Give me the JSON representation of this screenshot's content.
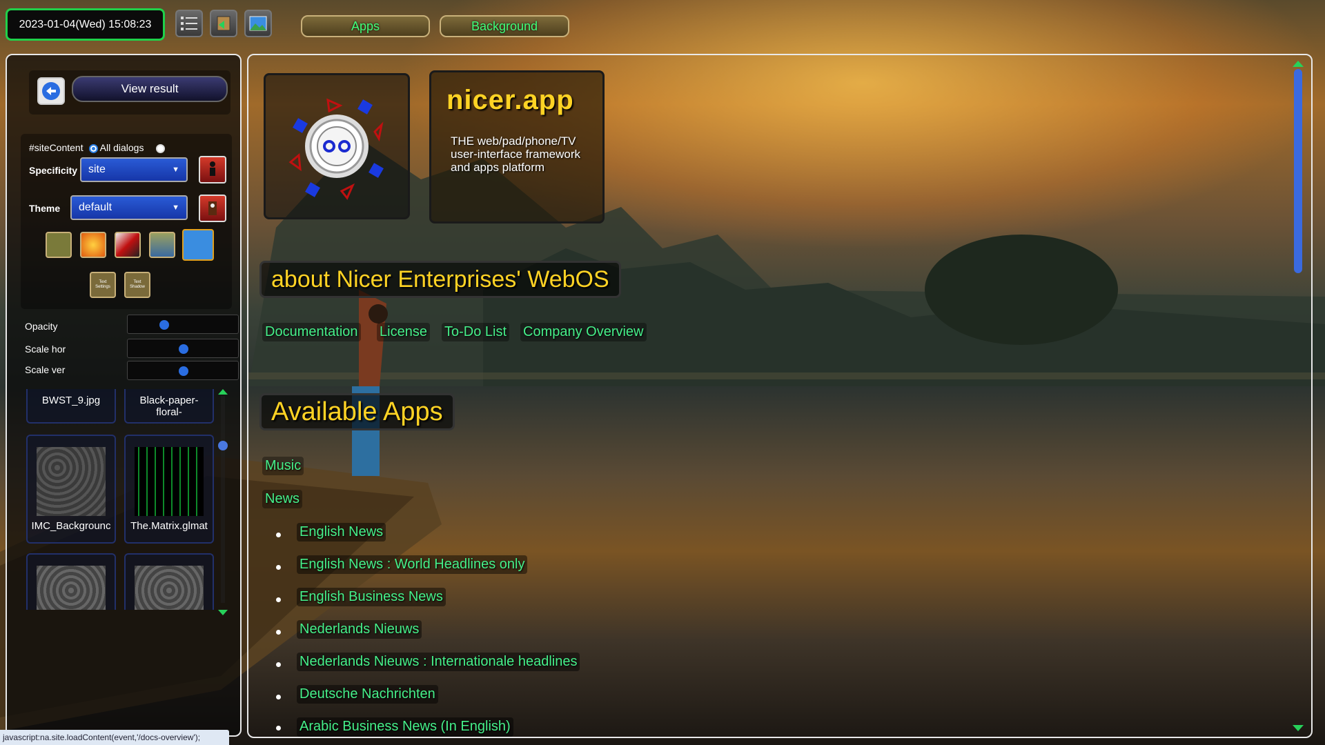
{
  "topbar": {
    "datetime": "2023-01-04(Wed) 15:08:23",
    "icons": [
      "list-icon",
      "upload-icon",
      "landscape-icon"
    ],
    "apps_label": "Apps",
    "background_label": "Background"
  },
  "leftpanel": {
    "view_result_label": "View result",
    "scope": {
      "site_content_label": "#siteContent",
      "all_dialogs_label": "All dialogs",
      "selected": "#siteContent"
    },
    "specificity": {
      "label": "Specificity",
      "value": "site"
    },
    "theme": {
      "label": "Theme",
      "value": "default"
    },
    "text_settings_label": "Text Settings",
    "text_shadow_label": "Text Shadow",
    "sliders": [
      {
        "label": "Opacity",
        "value": 0.33
      },
      {
        "label": "Scale hor",
        "value": 0.5
      },
      {
        "label": "Scale ver",
        "value": 0.5
      }
    ],
    "thumbnails": [
      {
        "name": "BWST_9.jpg"
      },
      {
        "name": "Black-paper-floral-"
      },
      {
        "name": "IMC_Backgrounc"
      },
      {
        "name": "The.Matrix.glmat"
      },
      {
        "name": ""
      },
      {
        "name": ""
      }
    ]
  },
  "statusbar": {
    "text": "javascript:na.site.loadContent(event,'/docs-overview');"
  },
  "main": {
    "brand": {
      "title": "nicer.app",
      "subtitle": "THE web/pad/phone/TV user-interface framework and apps platform"
    },
    "about_heading": "about Nicer Enterprises' WebOS",
    "nav": [
      "Documentation",
      "License",
      "To-Do List",
      "Company Overview"
    ],
    "apps_heading": "Available Apps",
    "apps": [
      "Music",
      "News"
    ],
    "news_items": [
      "English News",
      "English News : World Headlines only",
      "English Business News",
      "Nederlands Nieuws",
      "Nederlands Nieuws : Internationale headlines",
      "Deutsche Nachrichten",
      "Arabic Business News (In English)"
    ]
  },
  "colors": {
    "accent_green": "#46f08a",
    "heading_yellow": "#ffd324",
    "clock_border": "#1fd14a",
    "select_blue": "#1e4ac0"
  }
}
